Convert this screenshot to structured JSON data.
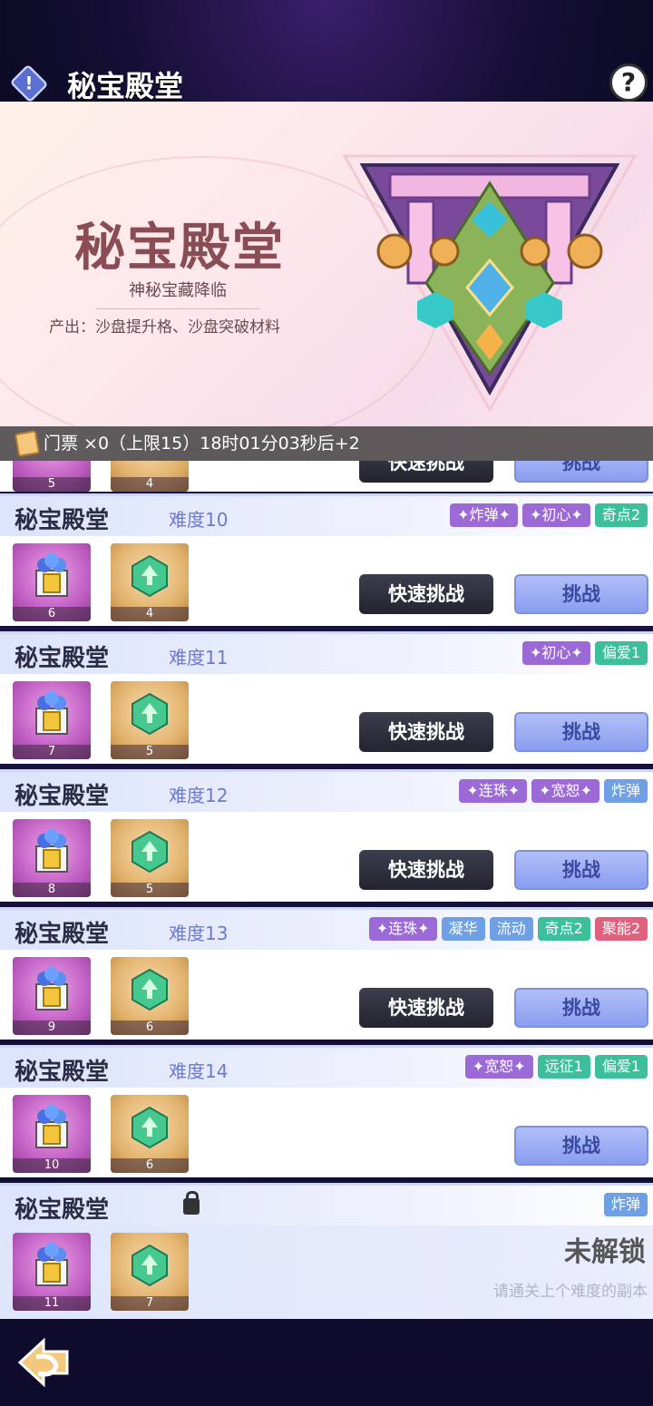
{
  "header": {
    "title": "秘宝殿堂",
    "info_icon": "!",
    "help_icon": "?"
  },
  "banner": {
    "title": "秘宝殿堂",
    "subtitle": "神秘宝藏降临",
    "output": "产出：沙盘提升格、沙盘突破材料"
  },
  "ticket": {
    "text": "门票 ×0（上限15）18时01分03秒后+2"
  },
  "partial": {
    "box_count": "5",
    "gem_count": "4",
    "quick_label": "快速挑战",
    "go_label": "挑战"
  },
  "stages": [
    {
      "name": "秘宝殿堂",
      "difficulty": "难度10",
      "box": "6",
      "gem": "4",
      "tags": [
        "✦炸弹✦",
        "✦初心✦",
        "奇点2"
      ],
      "tag_colors": [
        "purple",
        "purple",
        "teal"
      ]
    },
    {
      "name": "秘宝殿堂",
      "difficulty": "难度11",
      "box": "7",
      "gem": "5",
      "tags": [
        "✦初心✦",
        "偏爱1"
      ],
      "tag_colors": [
        "purple",
        "teal"
      ]
    },
    {
      "name": "秘宝殿堂",
      "difficulty": "难度12",
      "box": "8",
      "gem": "5",
      "tags": [
        "✦连珠✦",
        "✦宽恕✦",
        "炸弹"
      ],
      "tag_colors": [
        "purple",
        "purple",
        "blue"
      ]
    },
    {
      "name": "秘宝殿堂",
      "difficulty": "难度13",
      "box": "9",
      "gem": "6",
      "tags": [
        "✦连珠✦",
        "凝华",
        "流动",
        "奇点2",
        "聚能2"
      ],
      "tag_colors": [
        "purple",
        "blue",
        "blue",
        "teal",
        "pink"
      ]
    },
    {
      "name": "秘宝殿堂",
      "difficulty": "难度14",
      "box": "10",
      "gem": "6",
      "tags": [
        "✦宽恕✦",
        "远征1",
        "偏爱1"
      ],
      "tag_colors": [
        "purple",
        "teal",
        "teal"
      ]
    }
  ],
  "buttons": {
    "quick": "快速挑战",
    "go": "挑战"
  },
  "locked": {
    "name": "秘宝殿堂",
    "box": "11",
    "gem": "7",
    "tag": "炸弹",
    "title": "未解锁",
    "hint": "请通关上个难度的副本"
  },
  "colors": {
    "accent": "#8a9ef0",
    "tag_purple": "#9b6ad6",
    "tag_teal": "#3cbf9a",
    "tag_pink": "#e0607e",
    "tag_blue": "#6fa0e6"
  },
  "icons": {
    "back": "back-arrow-icon",
    "ticket": "ticket-icon",
    "lock": "lock-icon"
  }
}
